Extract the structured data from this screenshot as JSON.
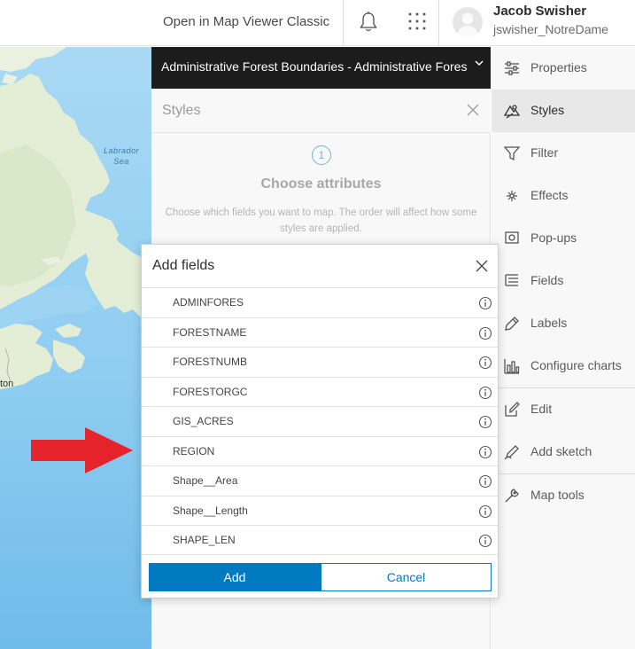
{
  "header": {
    "open_classic_label": "Open in Map Viewer Classic",
    "bell_icon": "bell-icon",
    "apps_icon": "apps-grid-icon",
    "user_name": "Jacob Swisher",
    "user_handle": "jswisher_NotreDame"
  },
  "map": {
    "sea_label_line1": "Labrador",
    "sea_label_line2": "Sea",
    "city_label": "ton",
    "colors": {
      "water": "#8dcbf0",
      "land": "#e6efd9",
      "deep_water": "#6bb8ea"
    }
  },
  "panel": {
    "layer_title": "Administrative Forest Boundaries - Administrative Forest Boundaries",
    "styles_title": "Styles",
    "step_number": "1",
    "step_title": "Choose attributes",
    "step_description": "Choose which fields you want to map. The order will affect how some styles are applied."
  },
  "rail": {
    "items": [
      {
        "label": "Properties",
        "icon": "properties-icon",
        "active": false
      },
      {
        "label": "Styles",
        "icon": "styles-icon",
        "active": true
      },
      {
        "label": "Filter",
        "icon": "filter-icon",
        "active": false
      },
      {
        "label": "Effects",
        "icon": "effects-icon",
        "active": false
      },
      {
        "label": "Pop-ups",
        "icon": "popups-icon",
        "active": false
      },
      {
        "label": "Fields",
        "icon": "fields-icon",
        "active": false
      },
      {
        "label": "Labels",
        "icon": "labels-icon",
        "active": false
      },
      {
        "label": "Configure charts",
        "icon": "charts-icon",
        "active": false
      },
      {
        "label": "Edit",
        "icon": "edit-icon",
        "active": false
      },
      {
        "label": "Add sketch",
        "icon": "sketch-icon",
        "active": false
      },
      {
        "label": "Map tools",
        "icon": "map-tools-icon",
        "active": false
      }
    ]
  },
  "modal": {
    "title": "Add fields",
    "fields": [
      "ADMINFORES",
      "FORESTNAME",
      "FORESTNUMB",
      "FORESTORGC",
      "GIS_ACRES",
      "REGION",
      "Shape__Area",
      "Shape__Length",
      "SHAPE_LEN"
    ],
    "add_label": "Add",
    "cancel_label": "Cancel",
    "accent_color": "#0079c1"
  },
  "annotation": {
    "arrow_color": "#e5242b",
    "arrow_target": "REGION"
  }
}
